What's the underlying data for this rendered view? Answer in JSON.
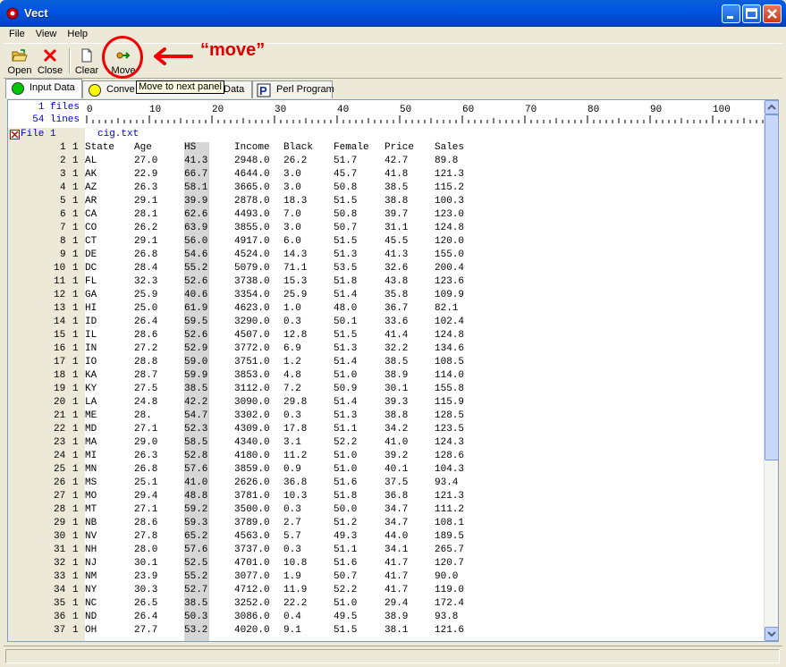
{
  "window": {
    "title": "Vect"
  },
  "menu": [
    "File",
    "View",
    "Help"
  ],
  "toolbar": {
    "open": "Open",
    "close": "Close",
    "clear": "Clear",
    "move": "Move"
  },
  "tooltip": "Move to next panel",
  "annotation": "“move”",
  "tabs": [
    {
      "label": "Input Data",
      "color": "#00c800"
    },
    {
      "label": "Conve",
      "color": "#ffff00"
    },
    {
      "label": "Data"
    },
    {
      "label": "Perl Program"
    }
  ],
  "ruler": {
    "files": "1 files",
    "lines": "54 lines",
    "ticks": [
      "0",
      "10",
      "20",
      "30",
      "40",
      "50",
      "60",
      "70",
      "80",
      "90",
      "100"
    ]
  },
  "file": {
    "label": "File 1",
    "name": "cig.txt"
  },
  "columns": [
    "State",
    "Age",
    "HS",
    "Income",
    "Black",
    "Female",
    "Price",
    "Sales"
  ],
  "rows": [
    [
      "2",
      "1",
      "AL",
      "27.0",
      "41.3",
      "2948.0",
      "26.2",
      "51.7",
      "42.7",
      "89.8"
    ],
    [
      "3",
      "1",
      "AK",
      "22.9",
      "66.7",
      "4644.0",
      "3.0",
      "45.7",
      "41.8",
      "121.3"
    ],
    [
      "4",
      "1",
      "AZ",
      "26.3",
      "58.1",
      "3665.0",
      "3.0",
      "50.8",
      "38.5",
      "115.2"
    ],
    [
      "5",
      "1",
      "AR",
      "29.1",
      "39.9",
      "2878.0",
      "18.3",
      "51.5",
      "38.8",
      "100.3"
    ],
    [
      "6",
      "1",
      "CA",
      "28.1",
      "62.6",
      "4493.0",
      "7.0",
      "50.8",
      "39.7",
      "123.0"
    ],
    [
      "7",
      "1",
      "CO",
      "26.2",
      "63.9",
      "3855.0",
      "3.0",
      "50.7",
      "31.1",
      "124.8"
    ],
    [
      "8",
      "1",
      "CT",
      "29.1",
      "56.0",
      "4917.0",
      "6.0",
      "51.5",
      "45.5",
      "120.0"
    ],
    [
      "9",
      "1",
      "DE",
      "26.8",
      "54.6",
      "4524.0",
      "14.3",
      "51.3",
      "41.3",
      "155.0"
    ],
    [
      "10",
      "1",
      "DC",
      "28.4",
      "55.2",
      "5079.0",
      "71.1",
      "53.5",
      "32.6",
      "200.4"
    ],
    [
      "11",
      "1",
      "FL",
      "32.3",
      "52.6",
      "3738.0",
      "15.3",
      "51.8",
      "43.8",
      "123.6"
    ],
    [
      "12",
      "1",
      "GA",
      "25.9",
      "40.6",
      "3354.0",
      "25.9",
      "51.4",
      "35.8",
      "109.9"
    ],
    [
      "13",
      "1",
      "HI",
      "25.0",
      "61.9",
      "4623.0",
      "1.0",
      "48.0",
      "36.7",
      "82.1"
    ],
    [
      "14",
      "1",
      "ID",
      "26.4",
      "59.5",
      "3290.0",
      "0.3",
      "50.1",
      "33.6",
      "102.4"
    ],
    [
      "15",
      "1",
      "IL",
      "28.6",
      "52.6",
      "4507.0",
      "12.8",
      "51.5",
      "41.4",
      "124.8"
    ],
    [
      "16",
      "1",
      "IN",
      "27.2",
      "52.9",
      "3772.0",
      "6.9",
      "51.3",
      "32.2",
      "134.6"
    ],
    [
      "17",
      "1",
      "IO",
      "28.8",
      "59.0",
      "3751.0",
      "1.2",
      "51.4",
      "38.5",
      "108.5"
    ],
    [
      "18",
      "1",
      "KA",
      "28.7",
      "59.9",
      "3853.0",
      "4.8",
      "51.0",
      "38.9",
      "114.0"
    ],
    [
      "19",
      "1",
      "KY",
      "27.5",
      "38.5",
      "3112.0",
      "7.2",
      "50.9",
      "30.1",
      "155.8"
    ],
    [
      "20",
      "1",
      "LA",
      "24.8",
      "42.2",
      "3090.0",
      "29.8",
      "51.4",
      "39.3",
      "115.9"
    ],
    [
      "21",
      "1",
      "ME",
      "28.",
      "54.7",
      "3302.0",
      "0.3",
      "51.3",
      "38.8",
      "128.5"
    ],
    [
      "22",
      "1",
      "MD",
      "27.1",
      "52.3",
      "4309.0",
      "17.8",
      "51.1",
      "34.2",
      "123.5"
    ],
    [
      "23",
      "1",
      "MA",
      "29.0",
      "58.5",
      "4340.0",
      "3.1",
      "52.2",
      "41.0",
      "124.3"
    ],
    [
      "24",
      "1",
      "MI",
      "26.3",
      "52.8",
      "4180.0",
      "11.2",
      "51.0",
      "39.2",
      "128.6"
    ],
    [
      "25",
      "1",
      "MN",
      "26.8",
      "57.6",
      "3859.0",
      "0.9",
      "51.0",
      "40.1",
      "104.3"
    ],
    [
      "26",
      "1",
      "MS",
      "25.1",
      "41.0",
      "2626.0",
      "36.8",
      "51.6",
      "37.5",
      "93.4"
    ],
    [
      "27",
      "1",
      "MO",
      "29.4",
      "48.8",
      "3781.0",
      "10.3",
      "51.8",
      "36.8",
      "121.3"
    ],
    [
      "28",
      "1",
      "MT",
      "27.1",
      "59.2",
      "3500.0",
      "0.3",
      "50.0",
      "34.7",
      "111.2"
    ],
    [
      "29",
      "1",
      "NB",
      "28.6",
      "59.3",
      "3789.0",
      "2.7",
      "51.2",
      "34.7",
      "108.1"
    ],
    [
      "30",
      "1",
      "NV",
      "27.8",
      "65.2",
      "4563.0",
      "5.7",
      "49.3",
      "44.0",
      "189.5"
    ],
    [
      "31",
      "1",
      "NH",
      "28.0",
      "57.6",
      "3737.0",
      "0.3",
      "51.1",
      "34.1",
      "265.7"
    ],
    [
      "32",
      "1",
      "NJ",
      "30.1",
      "52.5",
      "4701.0",
      "10.8",
      "51.6",
      "41.7",
      "120.7"
    ],
    [
      "33",
      "1",
      "NM",
      "23.9",
      "55.2",
      "3077.0",
      "1.9",
      "50.7",
      "41.7",
      "90.0"
    ],
    [
      "34",
      "1",
      "NY",
      "30.3",
      "52.7",
      "4712.0",
      "11.9",
      "52.2",
      "41.7",
      "119.0"
    ],
    [
      "35",
      "1",
      "NC",
      "26.5",
      "38.5",
      "3252.0",
      "22.2",
      "51.0",
      "29.4",
      "172.4"
    ],
    [
      "36",
      "1",
      "ND",
      "26.4",
      "50.3",
      "3086.0",
      "0.4",
      "49.5",
      "38.9",
      "93.8"
    ],
    [
      "37",
      "1",
      "OH",
      "27.7",
      "53.2",
      "4020.0",
      "9.1",
      "51.5",
      "38.1",
      "121.6"
    ]
  ]
}
